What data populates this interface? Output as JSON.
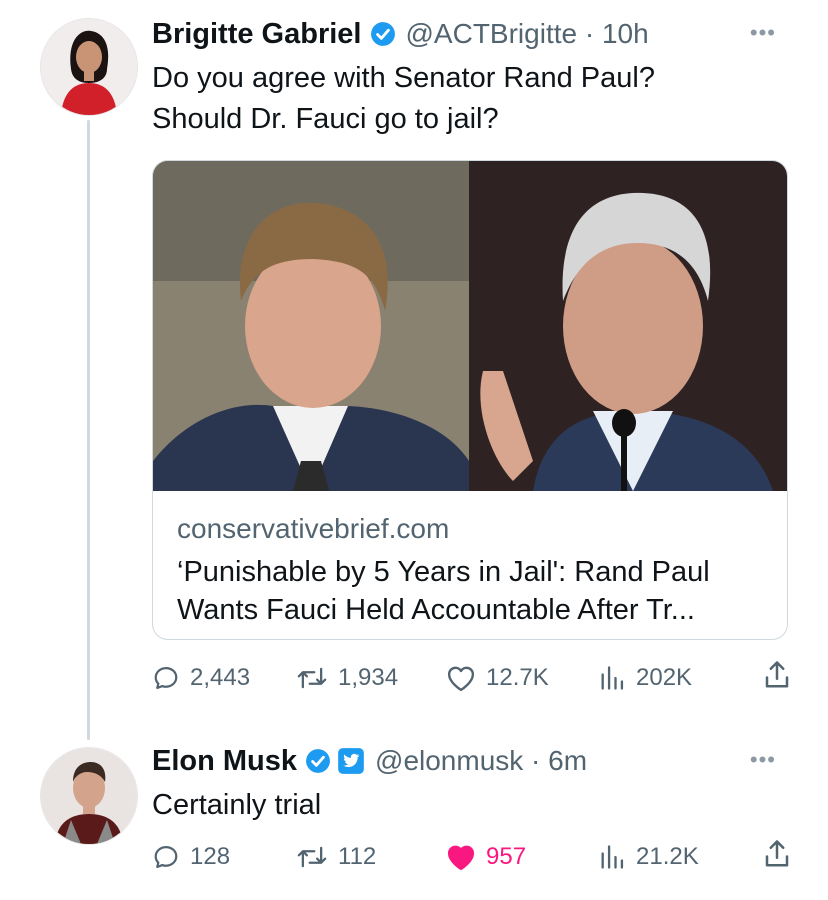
{
  "tweets": [
    {
      "name": "Brigitte Gabriel",
      "handle": "@ACTBrigitte · 10h",
      "text": "Do you agree with Senator Rand Paul?\nShould Dr. Fauci go to jail?",
      "card": {
        "domain": "conservativebrief.com",
        "title": "‘Punishable by 5 Years in Jail': Rand Paul Wants Fauci Held Accountable After Tr..."
      },
      "replies": "2,443",
      "retweets": "1,934",
      "likes": "12.7K",
      "views": "202K",
      "liked": false
    },
    {
      "name": "Elon Musk",
      "handle": "@elonmusk · 6m",
      "text": "Certainly trial",
      "replies": "128",
      "retweets": "112",
      "likes": "957",
      "views": "21.2K",
      "liked": true
    }
  ],
  "icons": {
    "more": "more-icon",
    "reply": "reply-icon",
    "retweet": "retweet-icon",
    "like": "heart-icon",
    "views": "views-icon",
    "share": "share-icon",
    "verified": "verified-badge-icon",
    "affiliate": "twitter-affiliate-badge"
  },
  "colors": {
    "verified": "#1d9bf0",
    "like": "#f91880",
    "secondary": "#536471"
  }
}
